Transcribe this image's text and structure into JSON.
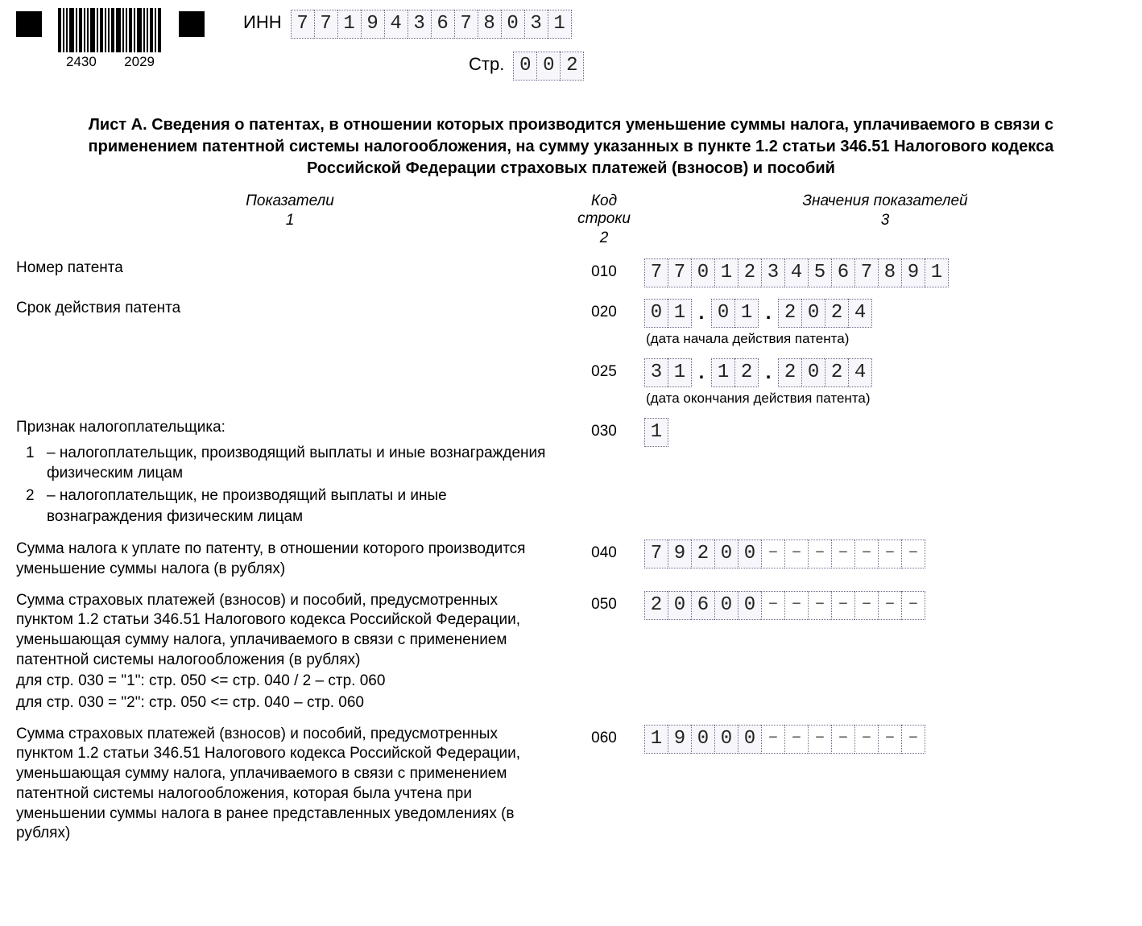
{
  "barcode": {
    "num1": "2430",
    "num2": "2029"
  },
  "inn": {
    "label": "ИНН",
    "value": "771943678031"
  },
  "page": {
    "label": "Стр.",
    "value": "002"
  },
  "title": "Лист А. Сведения о патентах, в отношении которых производится уменьшение суммы налога, уплачиваемого в связи с применением патентной системы налогообложения, на сумму указанных в пункте 1.2 статьи 346.51 Налогового кодекса Российской Федерации страховых платежей (взносов) и пособий",
  "columns": {
    "c1": "Показатели",
    "c1n": "1",
    "c2a": "Код",
    "c2b": "строки",
    "c2n": "2",
    "c3": "Значения показателей",
    "c3n": "3"
  },
  "rows": {
    "r010": {
      "label": "Номер патента",
      "code": "010",
      "value": "7701234567891"
    },
    "r020": {
      "label": "Срок действия патента",
      "code": "020",
      "dd": "01",
      "mm": "01",
      "yyyy": "2024",
      "hint": "(дата начала действия патента)"
    },
    "r025": {
      "code": "025",
      "dd": "31",
      "mm": "12",
      "yyyy": "2024",
      "hint": "(дата окончания действия патента)"
    },
    "r030": {
      "label": "Признак налогоплательщика:",
      "opt1_num": "1",
      "opt1_text": "– налогоплательщик, производящий выплаты и иные вознаграждения физическим лицам",
      "opt2_num": "2",
      "opt2_text": "– налогоплательщик, не производящий выплаты и иные вознаграждения физическим лицам",
      "code": "030",
      "value": "1"
    },
    "r040": {
      "label": "Сумма налога к уплате по патенту, в отношении которого производится уменьшение суммы налога (в рублях)",
      "code": "040",
      "value": "79200",
      "width": 12
    },
    "r050": {
      "label": "Сумма страховых платежей (взносов) и пособий, предусмотренных пунктом 1.2 статьи 346.51 Налогового кодекса Российской Федерации, уменьшающая сумму налога, уплачиваемого в связи с применением патентной системы налогообложения (в рублях)",
      "rule1": "для стр. 030 = \"1\": стр. 050 <= стр. 040 / 2 – стр. 060",
      "rule2": "для стр. 030 = \"2\": стр. 050 <= стр. 040 – стр. 060",
      "code": "050",
      "value": "20600",
      "width": 12
    },
    "r060": {
      "label": "Сумма страховых платежей (взносов) и пособий, предусмотренных пунктом 1.2 статьи 346.51 Налогового кодекса Российской Федерации, уменьшающая сумму налога, уплачиваемого в связи с применением патентной системы налогообложения, которая была учтена при уменьшении суммы налога в ранее представленных уведомлениях (в рублях)",
      "code": "060",
      "value": "19000",
      "width": 12
    }
  }
}
